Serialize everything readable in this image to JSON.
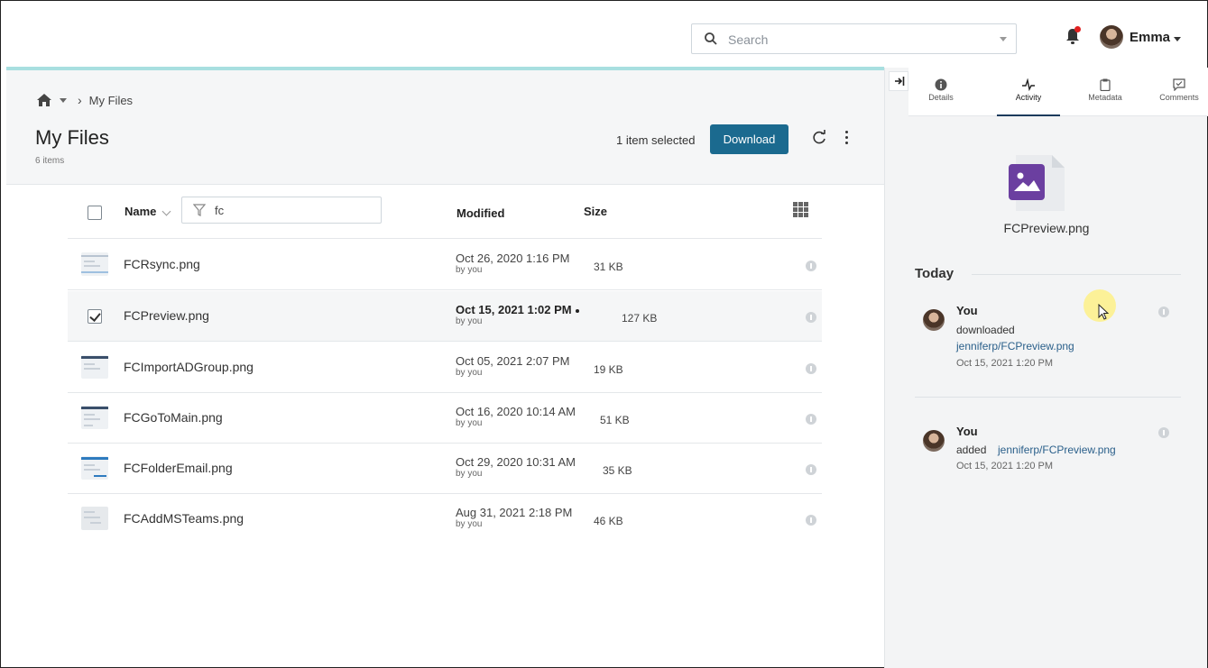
{
  "topbar": {
    "search_placeholder": "Search",
    "user_name": "Emma"
  },
  "breadcrumb": {
    "current": "My Files"
  },
  "header": {
    "title": "My Files",
    "item_count": "6 items",
    "selection_text": "1 item selected",
    "download_label": "Download"
  },
  "columns": {
    "name": "Name",
    "filter_value": "fc",
    "modified": "Modified",
    "size": "Size"
  },
  "files": [
    {
      "name": "FCRsync.png",
      "modified": "Oct 26, 2020 1:16 PM",
      "by": "by you",
      "size": "31 KB",
      "selected": false
    },
    {
      "name": "FCPreview.png",
      "modified": "Oct 15, 2021 1:02 PM",
      "by": "by you",
      "size": "127 KB",
      "selected": true
    },
    {
      "name": "FCImportADGroup.png",
      "modified": "Oct 05, 2021 2:07 PM",
      "by": "by you",
      "size": "19 KB",
      "selected": false
    },
    {
      "name": "FCGoToMain.png",
      "modified": "Oct 16, 2020 10:14 AM",
      "by": "by you",
      "size": "51 KB",
      "selected": false
    },
    {
      "name": "FCFolderEmail.png",
      "modified": "Oct 29, 2020 10:31 AM",
      "by": "by you",
      "size": "35 KB",
      "selected": false
    },
    {
      "name": "FCAddMSTeams.png",
      "modified": "Aug 31, 2021 2:18 PM",
      "by": "by you",
      "size": "46 KB",
      "selected": false
    }
  ],
  "panel": {
    "tabs": [
      "Details",
      "Activity",
      "Metadata",
      "Comments"
    ],
    "active_tab": "Activity",
    "file_name": "FCPreview.png",
    "section": "Today",
    "activities": [
      {
        "who": "You",
        "action": "downloaded",
        "target": "jenniferp/FCPreview.png",
        "date": "Oct 15, 2021 1:20 PM"
      },
      {
        "who": "You",
        "action": "added",
        "target": "jenniferp/FCPreview.png",
        "date": "Oct 15, 2021 1:20 PM"
      }
    ]
  },
  "colors": {
    "accent": "#1b6a8f",
    "progress": "#a8dfe0",
    "notification": "#e02020",
    "file_icon": "#6b3fa0"
  }
}
